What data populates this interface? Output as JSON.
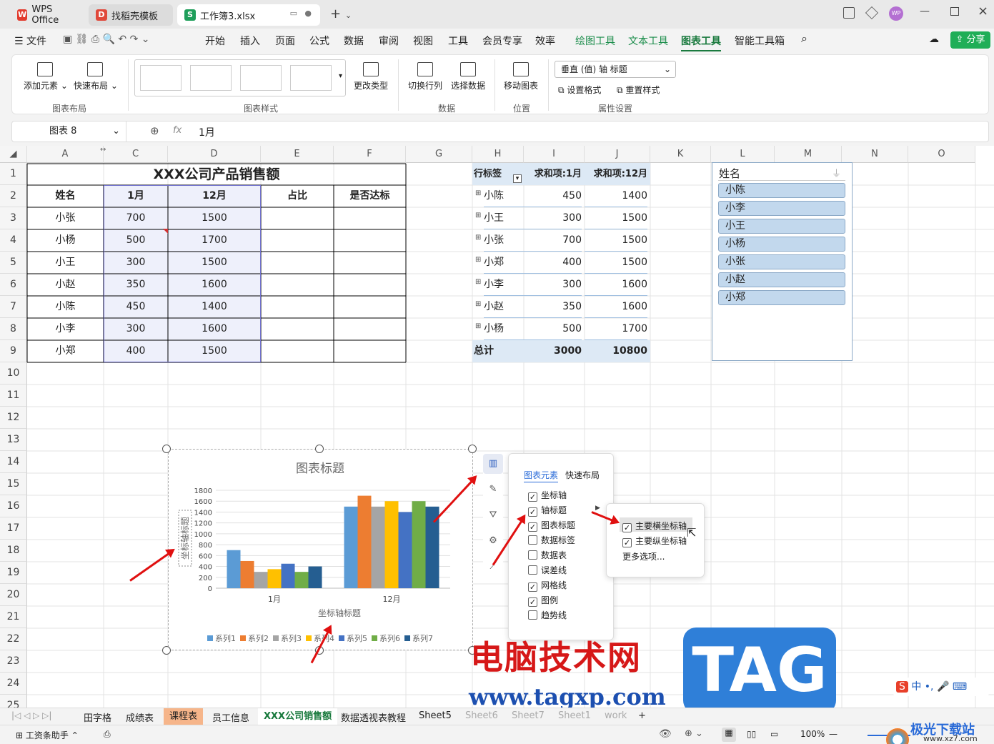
{
  "tabs": {
    "wps": "WPS Office",
    "template": "找稻壳模板",
    "file": "工作簿3.xlsx",
    "avatar": "WP"
  },
  "menu": {
    "file": "文件",
    "items": [
      "开始",
      "插入",
      "页面",
      "公式",
      "数据",
      "审阅",
      "视图",
      "工具",
      "会员专享",
      "效率"
    ],
    "tool_items": [
      "绘图工具",
      "文本工具"
    ],
    "active": "图表工具",
    "last": "智能工具箱",
    "share": "分享"
  },
  "ribbon": {
    "add_element": "添加元素",
    "quick_layout": "快速布局",
    "group_layout": "图表布局",
    "change_type": "更改类型",
    "group_style": "图表样式",
    "switch": "切换行列",
    "select_data": "选择数据",
    "group_data": "数据",
    "move_chart": "移动图表",
    "group_pos": "位置",
    "selector": "垂直 (值) 轴 标题",
    "set_format": "设置格式",
    "reset_style": "重置样式",
    "group_prop": "属性设置"
  },
  "formula": {
    "name_box": "图表 8",
    "fx": "fx",
    "value": "1月"
  },
  "columns": [
    "A",
    "",
    "C",
    "D",
    "E",
    "F",
    "G",
    "H",
    "I",
    "J",
    "K",
    "L",
    "M",
    "N",
    "O"
  ],
  "rows": [
    "1",
    "2",
    "3",
    "4",
    "5",
    "6",
    "7",
    "8",
    "9",
    "10",
    "11",
    "12",
    "13",
    "14",
    "15",
    "16",
    "17",
    "18",
    "19",
    "20",
    "21",
    "22",
    "23",
    "24",
    "25"
  ],
  "table": {
    "title": "XXX公司产品销售额",
    "headers": [
      "姓名",
      "1月",
      "12月",
      "占比",
      "是否达标"
    ],
    "rows": [
      [
        "小张",
        "700",
        "1500"
      ],
      [
        "小杨",
        "500",
        "1700"
      ],
      [
        "小王",
        "300",
        "1500"
      ],
      [
        "小赵",
        "350",
        "1600"
      ],
      [
        "小陈",
        "450",
        "1400"
      ],
      [
        "小李",
        "300",
        "1600"
      ],
      [
        "小郑",
        "400",
        "1500"
      ]
    ]
  },
  "pivot": {
    "headers": [
      "行标签",
      "求和项:1月",
      "求和项:12月"
    ],
    "rows": [
      [
        "小陈",
        "450",
        "1400"
      ],
      [
        "小王",
        "300",
        "1500"
      ],
      [
        "小张",
        "700",
        "1500"
      ],
      [
        "小郑",
        "400",
        "1500"
      ],
      [
        "小李",
        "300",
        "1600"
      ],
      [
        "小赵",
        "350",
        "1600"
      ],
      [
        "小杨",
        "500",
        "1700"
      ]
    ],
    "total": [
      "总计",
      "3000",
      "10800"
    ]
  },
  "slicer": {
    "title": "姓名",
    "items": [
      "小陈",
      "小李",
      "小王",
      "小杨",
      "小张",
      "小赵",
      "小郑"
    ]
  },
  "chart_data": {
    "type": "bar",
    "title": "图表标题",
    "categories": [
      "1月",
      "12月"
    ],
    "xlabel": "坐标轴标题",
    "ylabel": "坐标轴标题",
    "ylim": [
      0,
      1800
    ],
    "yticks": [
      "1800",
      "1600",
      "1400",
      "1200",
      "1000",
      "800",
      "600",
      "400",
      "200",
      "0"
    ],
    "series": [
      {
        "name": "系列1",
        "values": [
          700,
          1500
        ],
        "color": "#5b9bd5"
      },
      {
        "name": "系列2",
        "values": [
          500,
          1700
        ],
        "color": "#ed7d31"
      },
      {
        "name": "系列3",
        "values": [
          300,
          1500
        ],
        "color": "#a5a5a5"
      },
      {
        "name": "系列4",
        "values": [
          350,
          1600
        ],
        "color": "#ffc000"
      },
      {
        "name": "系列5",
        "values": [
          450,
          1400
        ],
        "color": "#4472c4"
      },
      {
        "name": "系列6",
        "values": [
          300,
          1600
        ],
        "color": "#70ad47"
      },
      {
        "name": "系列7",
        "values": [
          400,
          1500
        ],
        "color": "#255e91"
      }
    ]
  },
  "panel": {
    "tab1": "图表元素",
    "tab2": "快速布局",
    "items": [
      {
        "label": "坐标轴",
        "checked": true
      },
      {
        "label": "轴标题",
        "checked": true
      },
      {
        "label": "图表标题",
        "checked": true
      },
      {
        "label": "数据标签",
        "checked": false
      },
      {
        "label": "数据表",
        "checked": false
      },
      {
        "label": "误差线",
        "checked": false
      },
      {
        "label": "网格线",
        "checked": true
      },
      {
        "label": "图例",
        "checked": true
      },
      {
        "label": "趋势线",
        "checked": false
      }
    ]
  },
  "submenu": {
    "h": "主要横坐标轴",
    "v": "主要纵坐标轴",
    "more": "更多选项..."
  },
  "sheets": [
    "田字格",
    "成绩表",
    "课程表",
    "员工信息",
    "XXX公司销售额",
    "数据透视表教程",
    "Sheet5",
    "Sheet6",
    "Sheet7",
    "Sheet1",
    "work"
  ],
  "status": {
    "assistant": "工资条助手",
    "zoom": "100%"
  },
  "watermark": {
    "cn": "电脑技术网",
    "tag": "TAG",
    "url": "www.tagxp.com",
    "site": "极光下载站",
    "site_url": "www.xz7.com"
  }
}
